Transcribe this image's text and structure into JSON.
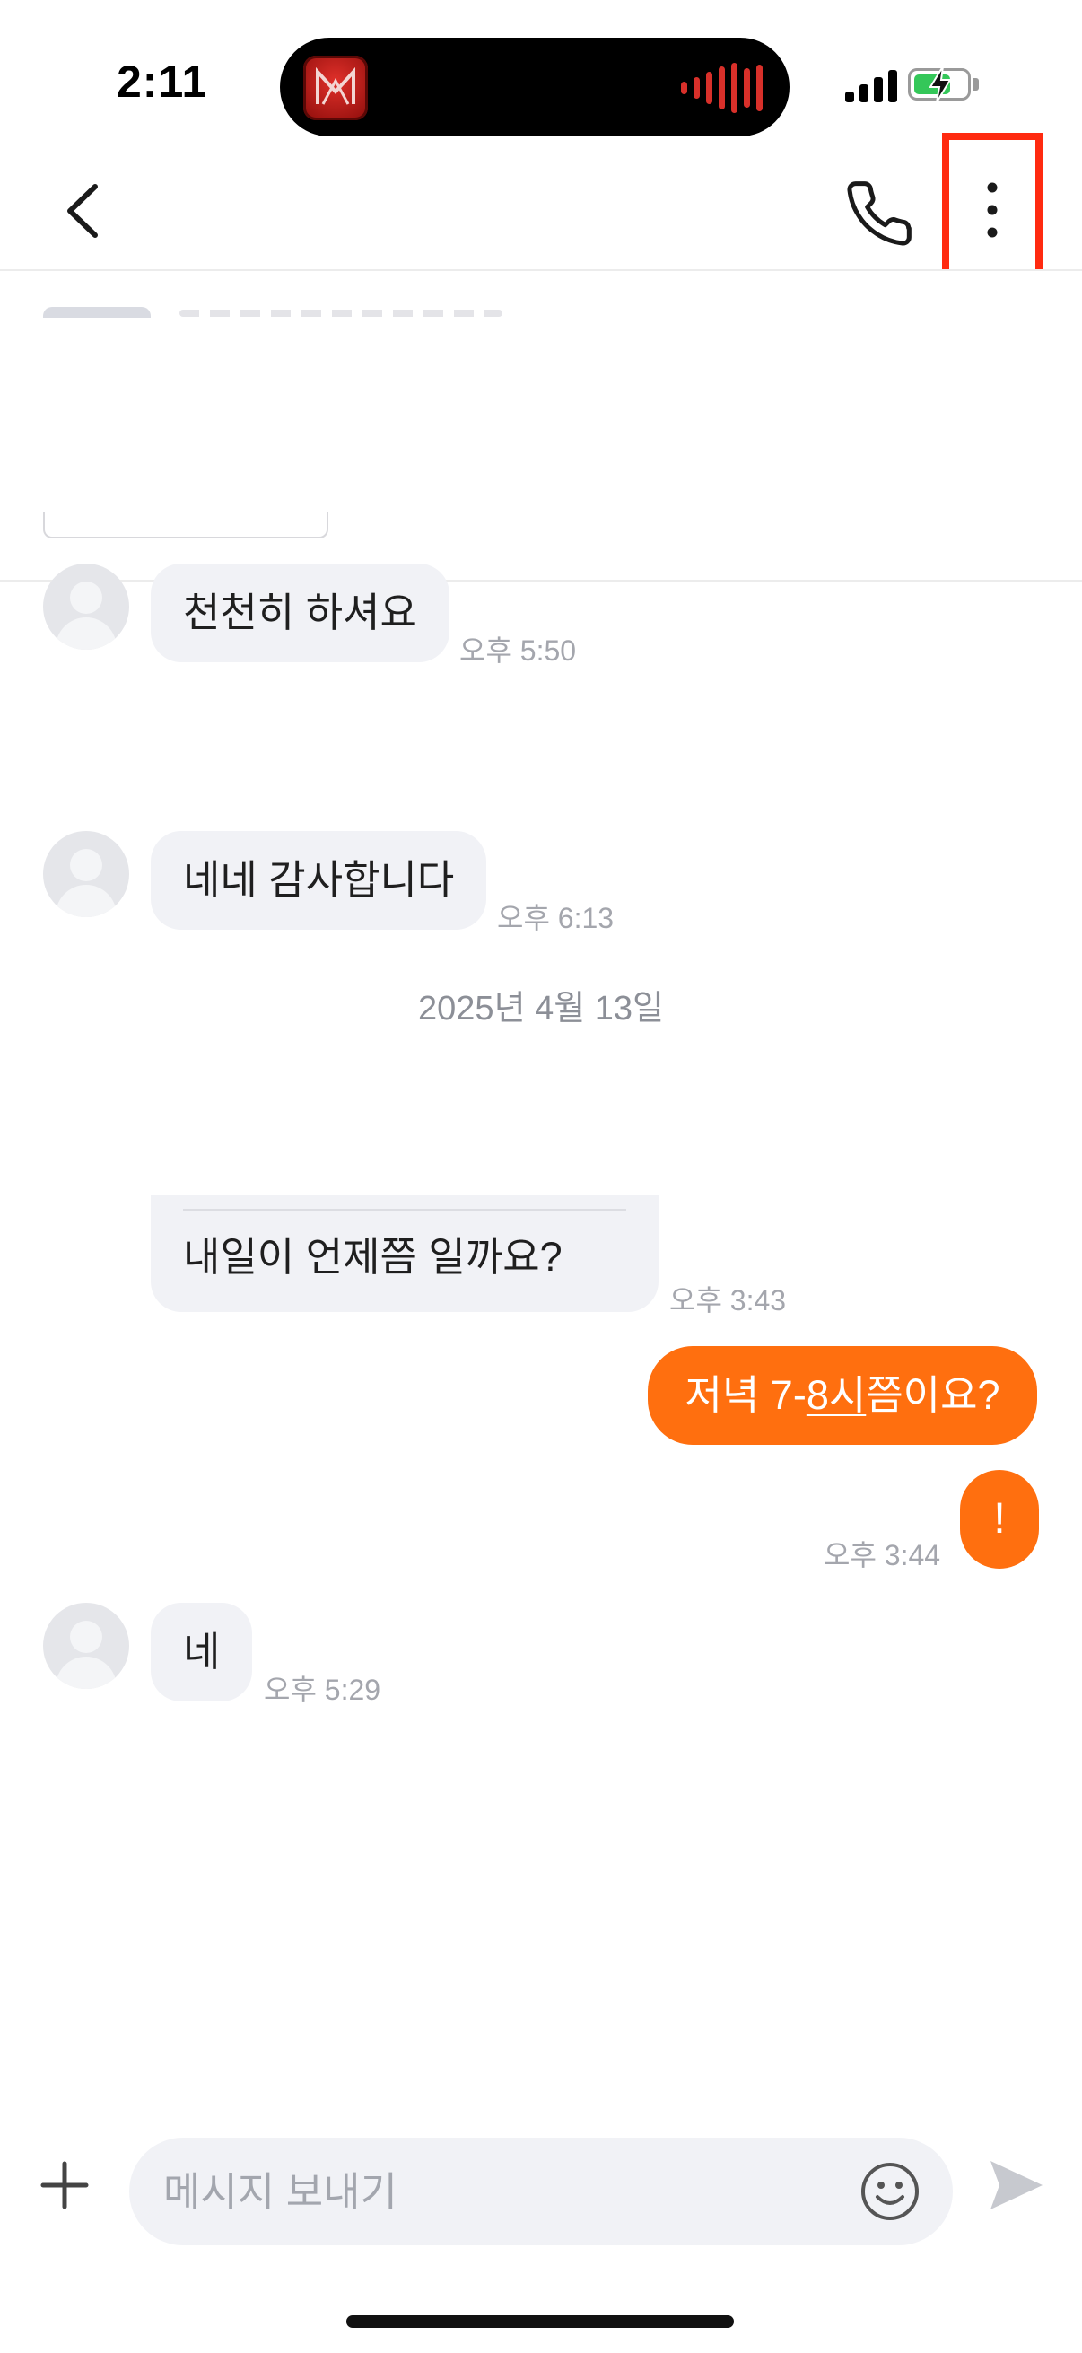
{
  "status_bar": {
    "time": "2:11",
    "battery": "charging",
    "signal_bars": 4
  },
  "header": {
    "back_icon": "chevron-left-icon",
    "call_icon": "phone-icon",
    "more_icon": "more-vertical-icon"
  },
  "messages": [
    {
      "direction": "in",
      "text": "천천히 하셔요",
      "time": "오후 5:50"
    },
    {
      "direction": "in",
      "text": "네네 감사합니다",
      "time": "오후 6:13"
    },
    {
      "direction": "in",
      "text": "내일이 언제쯤 일까요?",
      "time": "오후 3:43"
    },
    {
      "direction": "out",
      "text_parts": [
        "저녁 7-",
        "8시",
        "쯤이요?"
      ],
      "time": "오후 3:44",
      "status": "!"
    },
    {
      "direction": "in",
      "text": "네",
      "time": "오후 5:29"
    }
  ],
  "date_separator": "2025년 4월 13일",
  "composer": {
    "placeholder": "메시지 보내기",
    "plus_icon": "plus-icon",
    "emoji_icon": "smile-icon",
    "send_icon": "send-icon"
  },
  "colors": {
    "accent": "#ff6f0f",
    "bubble_in": "#f1f2f6",
    "highlight_box": "#ff2a10"
  }
}
